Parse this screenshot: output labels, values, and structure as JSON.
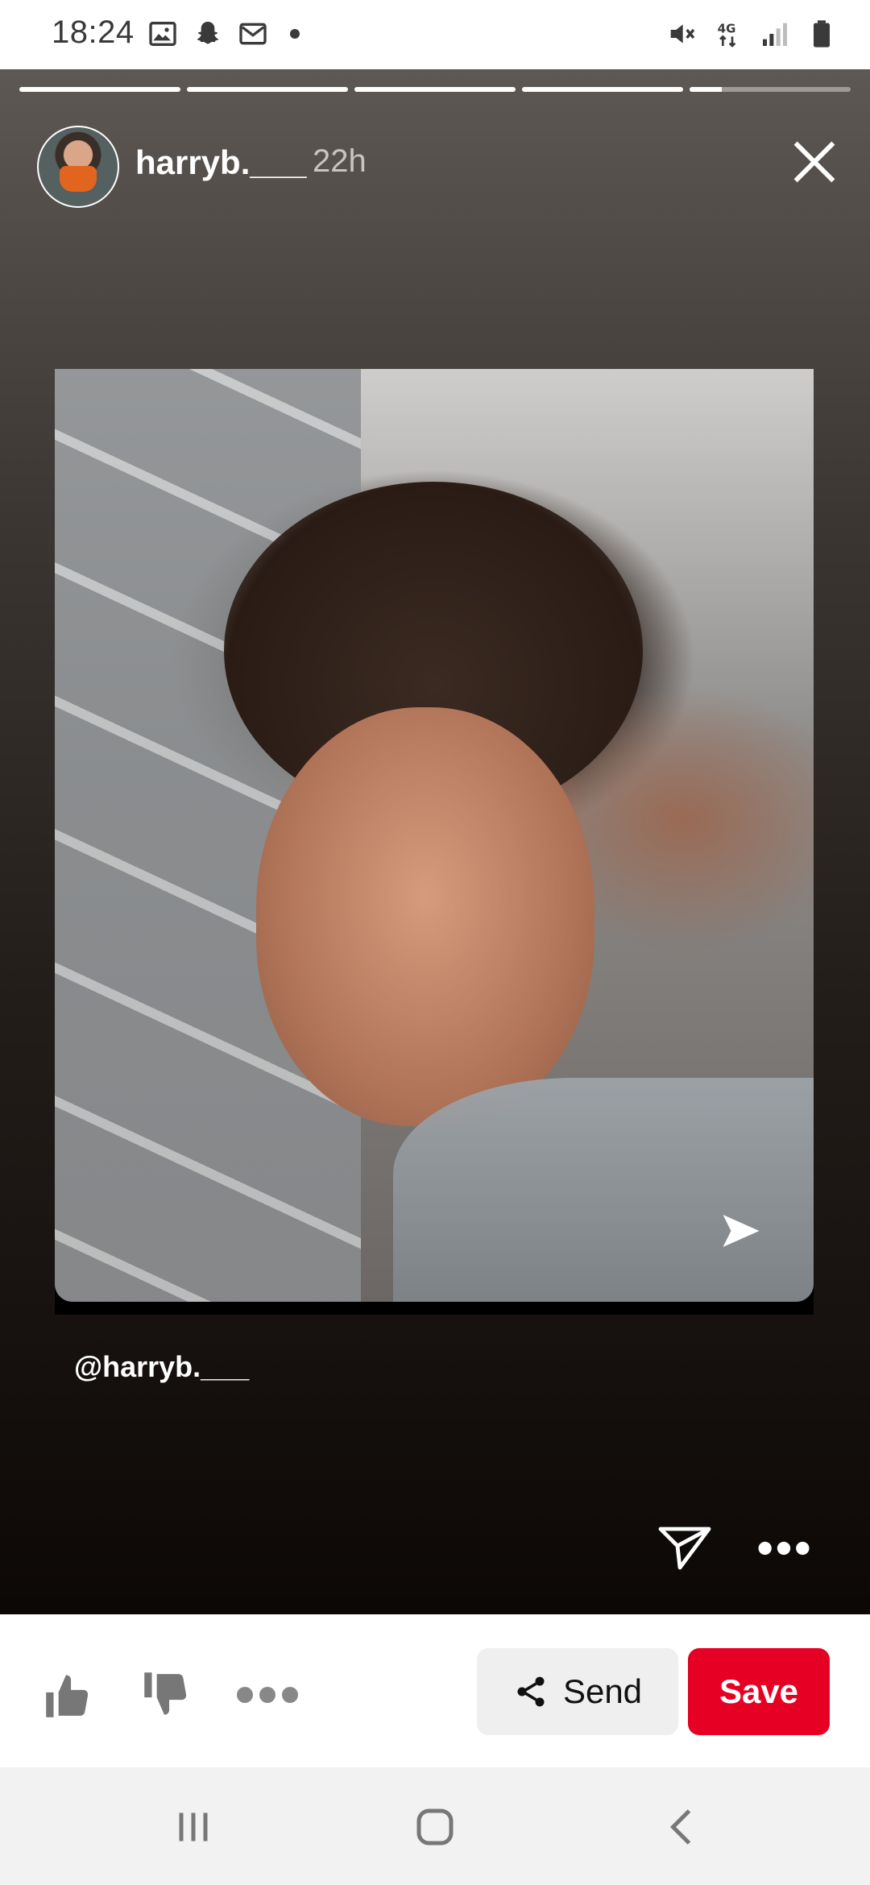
{
  "status_bar": {
    "time": "18:24",
    "left_icons": [
      "gallery-icon",
      "snapchat-icon",
      "gmail-icon",
      "notification-dot-icon"
    ],
    "right_icons": [
      "mute-icon",
      "4g-data-icon",
      "signal-icon",
      "battery-icon"
    ],
    "network": "4G"
  },
  "story": {
    "progress_segments": [
      1,
      1,
      1,
      1,
      0.2
    ],
    "username": "harryb.___",
    "time_ago": "22h",
    "mention": "@harryb.___",
    "icons": [
      "close-icon",
      "send-story-icon",
      "more-options-icon",
      "forward-arrow-icon"
    ]
  },
  "actions": {
    "send_label": "Send",
    "save_label": "Save",
    "icons": [
      "thumbs-up-icon",
      "thumbs-down-icon",
      "more-icon",
      "share-icon"
    ],
    "save_color": "#e60023"
  },
  "nav": {
    "icons": [
      "recents-icon",
      "home-icon",
      "back-icon"
    ]
  }
}
